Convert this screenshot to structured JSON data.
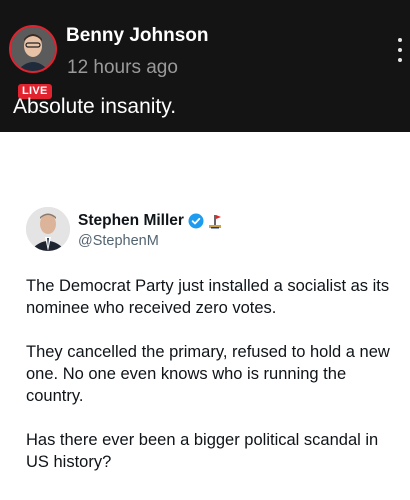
{
  "post": {
    "author": "Benny Johnson",
    "live_badge": "LIVE",
    "time": "12 hours ago",
    "text": "Absolute insanity."
  },
  "embedded_tweet": {
    "name": "Stephen Miller",
    "handle": "@StephenM",
    "paragraphs": [
      "The Democrat Party just installed a socialist as its nominee who received zero votes.",
      "They cancelled the primary, refused to hold a new one. No one even knows who is running the country.",
      "Has there ever been a bigger political scandal in US history?"
    ]
  },
  "colors": {
    "header_bg": "#141414",
    "live_red": "#e0232e",
    "verified_blue": "#1d9bf0"
  },
  "icons": [
    "more-vertical-icon",
    "verified-badge-icon",
    "flag-icon"
  ]
}
